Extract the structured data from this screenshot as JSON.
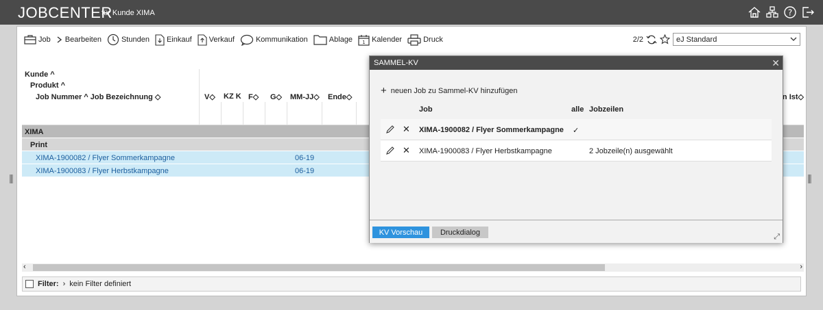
{
  "header": {
    "title": "JOBCENTER",
    "subtitle": "für Kunde XIMA"
  },
  "toolbar": {
    "items": [
      {
        "label": "Job",
        "icon": "briefcase-icon"
      },
      {
        "label": "Bearbeiten",
        "icon": "chevron-right-icon"
      },
      {
        "label": "Stunden",
        "icon": "clock-icon"
      },
      {
        "label": "Einkauf",
        "icon": "download-doc-icon"
      },
      {
        "label": "Verkauf",
        "icon": "upload-doc-icon"
      },
      {
        "label": "Kommunikation",
        "icon": "speech-bubble-icon"
      },
      {
        "label": "Ablage",
        "icon": "folder-icon"
      },
      {
        "label": "Kalender",
        "icon": "calendar-icon"
      },
      {
        "label": "Druck",
        "icon": "printer-icon"
      }
    ],
    "page_counter": "2/2",
    "view_select": "eJ Standard"
  },
  "table": {
    "header_levels": [
      "Kunde ^",
      "Produkt ^",
      "Job Nummer ^ Job Bezeichnung ◇"
    ],
    "columns": [
      "V◇",
      "KZ K",
      "F◇",
      "G◇",
      "MM-JJ◇",
      "Ende◇"
    ],
    "right_column": "n Ist◇",
    "group": "XIMA",
    "subgroup": "Print",
    "rows": [
      {
        "job": "XIMA-1900082 / Flyer Sommerkampagne",
        "mmjj": "06-19"
      },
      {
        "job": "XIMA-1900083 / Flyer Herbstkampagne",
        "mmjj": "06-19"
      }
    ]
  },
  "filter": {
    "label": "Filter:",
    "value": "kein Filter definiert"
  },
  "dialog": {
    "title": "SAMMEL-KV",
    "add_label": "neuen Job zu Sammel-KV hinzufügen",
    "columns": {
      "job": "Job",
      "alle": "alle",
      "jobzeilen": "Jobzeilen"
    },
    "rows": [
      {
        "job": "XIMA-1900082 / Flyer Sommerkampagne",
        "alle": "✓",
        "jobzeilen": ""
      },
      {
        "job": "XIMA-1900083 / Flyer Herbstkampagne",
        "alle": "",
        "jobzeilen": "2 Jobzeile(n) ausgewählt"
      }
    ],
    "buttons": {
      "preview": "KV Vorschau",
      "print": "Druckdialog"
    }
  }
}
